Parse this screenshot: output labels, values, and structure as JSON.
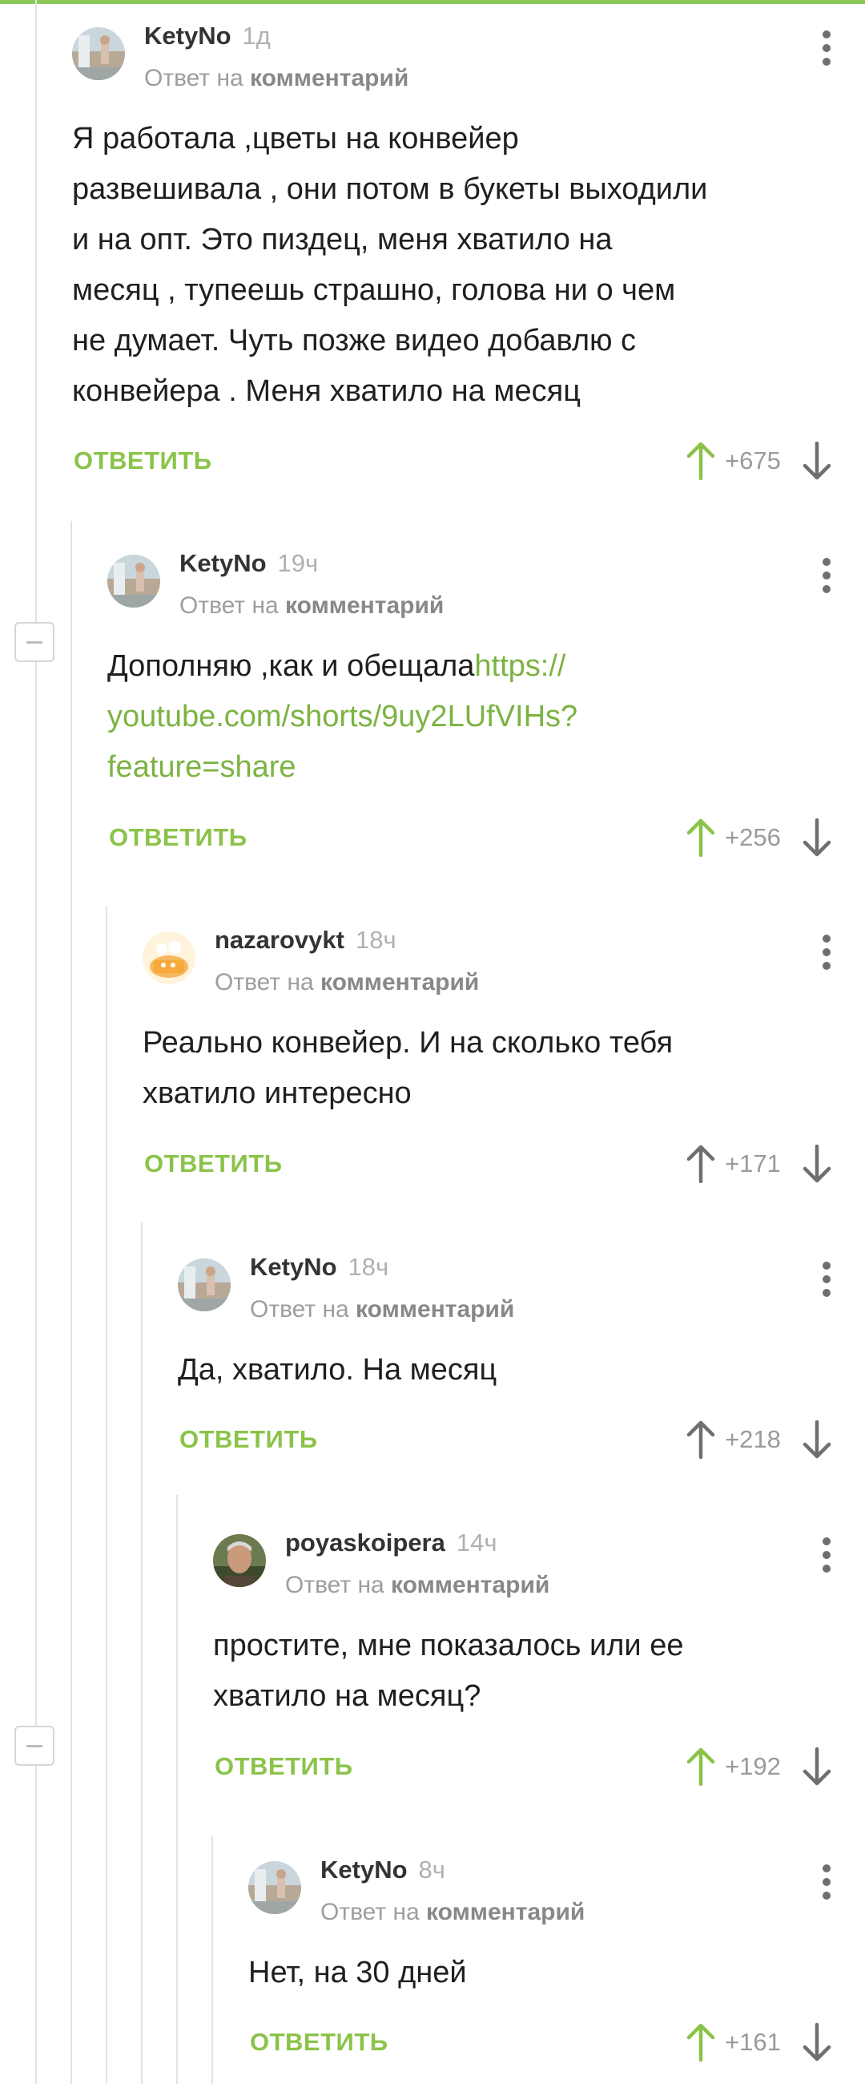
{
  "theme": {
    "accent": "#8ac858",
    "link": "#7cb342",
    "vote_up_active": "#8bc34a",
    "vote_neutral": "#6f6f6f"
  },
  "comments": [
    {
      "author": "KetyNo",
      "time": "1д",
      "reply_prefix": "Ответ на",
      "reply_target": "комментарий",
      "text_lines": [
        "Я работала ,цветы на конвейер",
        "развешивала , они потом в букеты выходили",
        "и на опт. Это пиздец, меня хватило на",
        "месяц , тупеешь страшно, голова ни о чем",
        "не думает. Чуть позже видео добавлю с",
        "конвейера . Меня хватило на месяц"
      ],
      "reply_label": "ОТВЕТИТЬ",
      "score": "+675",
      "upvoted": true,
      "avatar": "landscape-photo-avatar"
    },
    {
      "author": "KetyNo",
      "time": "19ч",
      "reply_prefix": "Ответ на",
      "reply_target": "комментарий",
      "text_intro": "Дополняю ,как и обещала",
      "link_lines": [
        "https://",
        "youtube.com/shorts/9uy2LUfVIHs?",
        "feature=share"
      ],
      "reply_label": "ОТВЕТИТЬ",
      "score": "+256",
      "upvoted": true,
      "avatar": "landscape-photo-avatar"
    },
    {
      "author": "nazarovykt",
      "time": "18ч",
      "reply_prefix": "Ответ на",
      "reply_target": "комментарий",
      "text_lines": [
        "Реально конвейер. И на сколько тебя",
        "хватило интересно"
      ],
      "reply_label": "ОТВЕТИТЬ",
      "score": "+171",
      "upvoted": false,
      "avatar": "cartoon-avatar"
    },
    {
      "author": "KetyNo",
      "time": "18ч",
      "reply_prefix": "Ответ на",
      "reply_target": "комментарий",
      "text_lines": [
        "Да, хватило. На месяц"
      ],
      "reply_label": "ОТВЕТИТЬ",
      "score": "+218",
      "upvoted": false,
      "avatar": "landscape-photo-avatar"
    },
    {
      "author": "poyaskoipera",
      "time": "14ч",
      "reply_prefix": "Ответ на",
      "reply_target": "комментарий",
      "text_lines": [
        "простите, мне показалось или ее",
        "хватило на месяц?"
      ],
      "reply_label": "ОТВЕТИТЬ",
      "score": "+192",
      "upvoted": true,
      "avatar": "portrait-photo-avatar"
    },
    {
      "author": "KetyNo",
      "time": "8ч",
      "reply_prefix": "Ответ на",
      "reply_target": "комментарий",
      "text_lines": [
        "Нет, на 30 дней"
      ],
      "reply_label": "ОТВЕТИТЬ",
      "score": "+161",
      "upvoted": true,
      "avatar": "landscape-photo-avatar"
    }
  ]
}
